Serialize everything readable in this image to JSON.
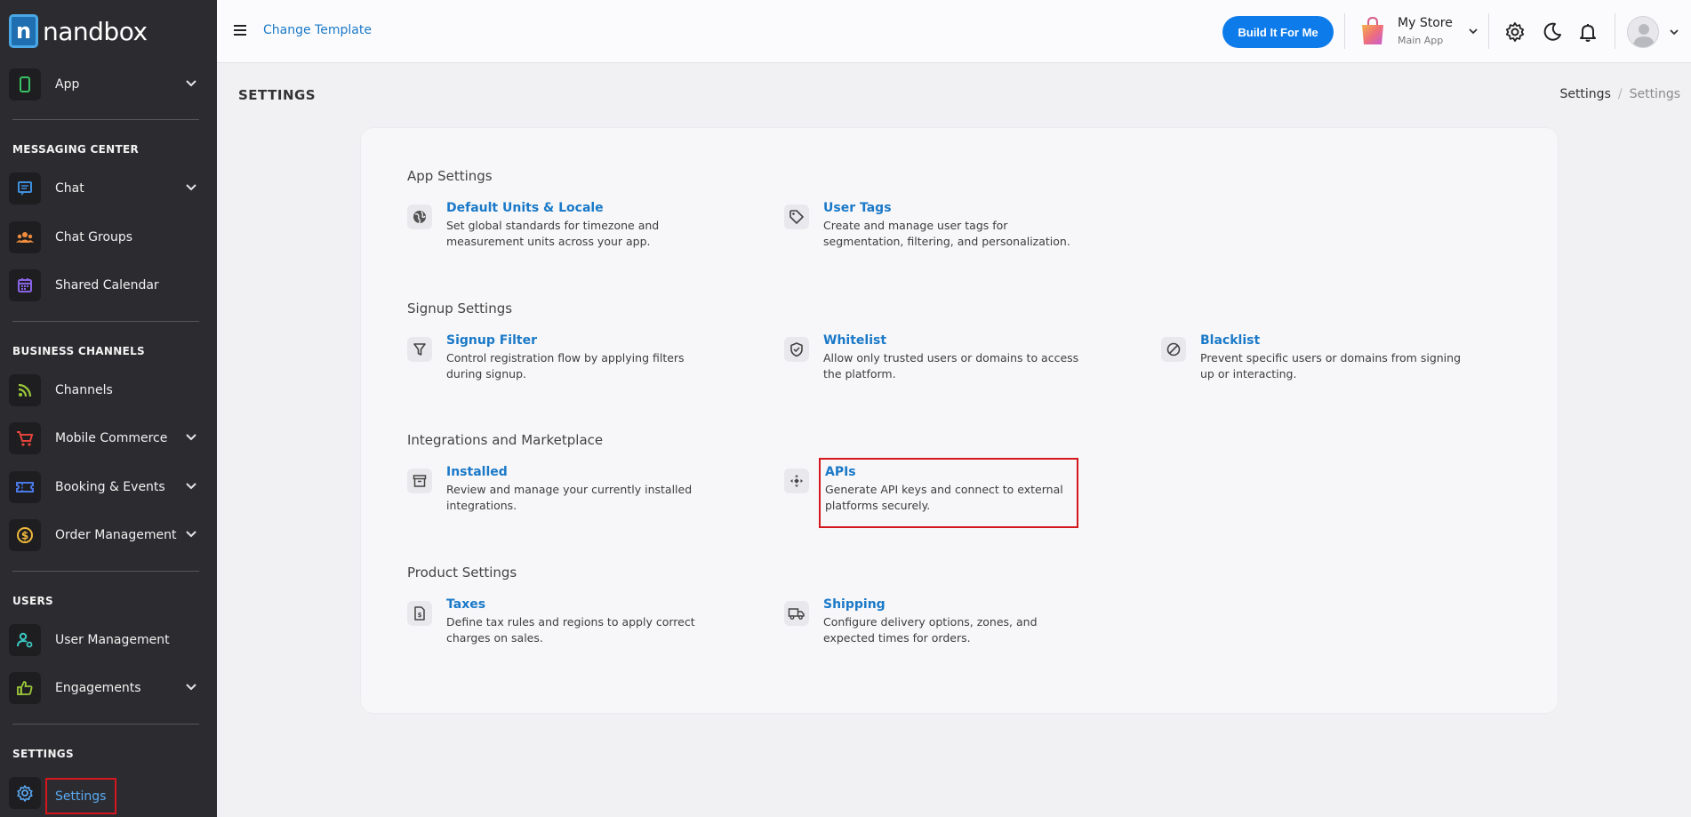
{
  "brand": {
    "name": "nandbox",
    "mark": "n"
  },
  "sidebar": {
    "app_label": "App",
    "sections": {
      "messaging": "MESSAGING CENTER",
      "business": "BUSINESS CHANNELS",
      "users": "USERS",
      "settings": "SETTINGS"
    },
    "items": {
      "chat": "Chat",
      "chat_groups": "Chat Groups",
      "shared_calendar": "Shared Calendar",
      "channels": "Channels",
      "mobile_commerce": "Mobile Commerce",
      "booking_events": "Booking & Events",
      "order_management": "Order Management",
      "user_management": "User Management",
      "engagements": "Engagements",
      "settings": "Settings"
    }
  },
  "topbar": {
    "change_template": "Change Template",
    "build_button": "Build It For Me",
    "store_name": "My Store",
    "store_sub": "Main App"
  },
  "page": {
    "title": "SETTINGS",
    "breadcrumb": [
      "Settings",
      "/",
      "Settings"
    ]
  },
  "groups": {
    "app": {
      "title": "App Settings",
      "items": [
        {
          "title": "Default Units & Locale",
          "desc": "Set global standards for timezone and measurement units across your app."
        },
        {
          "title": "User Tags",
          "desc": "Create and manage user tags for segmentation, filtering, and personalization."
        }
      ]
    },
    "signup": {
      "title": "Signup Settings",
      "items": [
        {
          "title": "Signup Filter",
          "desc": "Control registration flow by applying filters during signup."
        },
        {
          "title": "Whitelist",
          "desc": "Allow only trusted users or domains to access the platform."
        },
        {
          "title": "Blacklist",
          "desc": "Prevent specific users or domains from signing up or interacting."
        }
      ]
    },
    "integrations": {
      "title": "Integrations and Marketplace",
      "items": [
        {
          "title": "Installed",
          "desc": "Review and manage your currently installed integrations."
        },
        {
          "title": "APIs",
          "desc": "Generate API keys and connect to external platforms securely."
        }
      ]
    },
    "product": {
      "title": "Product Settings",
      "items": [
        {
          "title": "Taxes",
          "desc": "Define tax rules and regions to apply correct charges on sales."
        },
        {
          "title": "Shipping",
          "desc": "Configure delivery options, zones, and expected times for orders."
        }
      ]
    }
  },
  "colors": {
    "accent": "#0d7bea",
    "link": "#1a79c8",
    "sidebar_bg": "#2c2c30",
    "highlight": "#d4161d"
  }
}
